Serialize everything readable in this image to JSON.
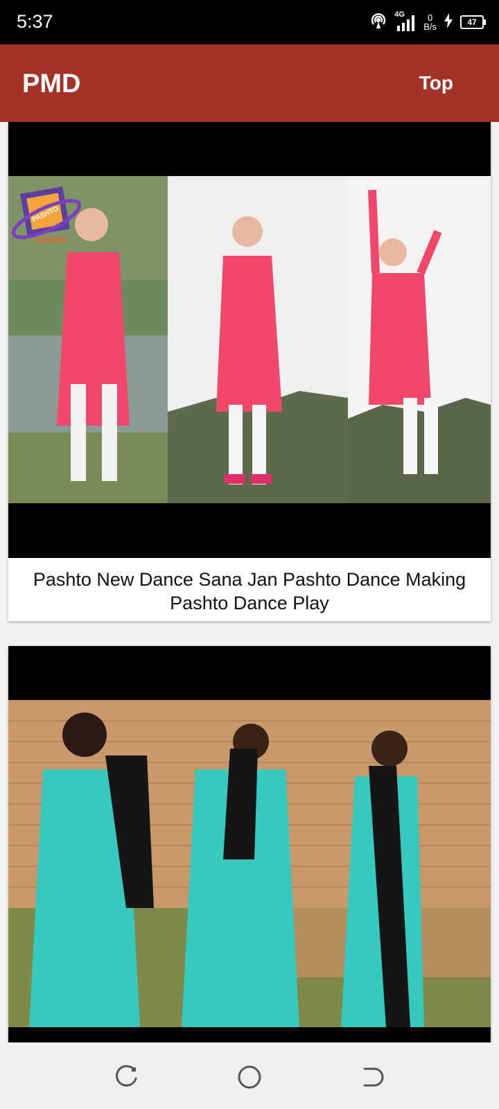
{
  "status_bar": {
    "time": "5:37",
    "network": "4G",
    "speed_value": "0",
    "speed_unit": "B/s",
    "battery": "47"
  },
  "app_bar": {
    "title": "PMD",
    "top_label": "Top"
  },
  "feed": {
    "items": [
      {
        "title": "Pashto New Dance Sana Jan Pashto Dance Making Pashto Dance Play",
        "logo_text_top": "PASHTO",
        "logo_text_bottom": "SCREEN"
      },
      {
        "title": ""
      }
    ]
  },
  "colors": {
    "app_bar": "#a53227",
    "status_bar": "#000000",
    "background": "#f2f2f2"
  },
  "nav_bar": {
    "icons": [
      "recent-apps-icon",
      "home-icon",
      "back-icon"
    ]
  }
}
